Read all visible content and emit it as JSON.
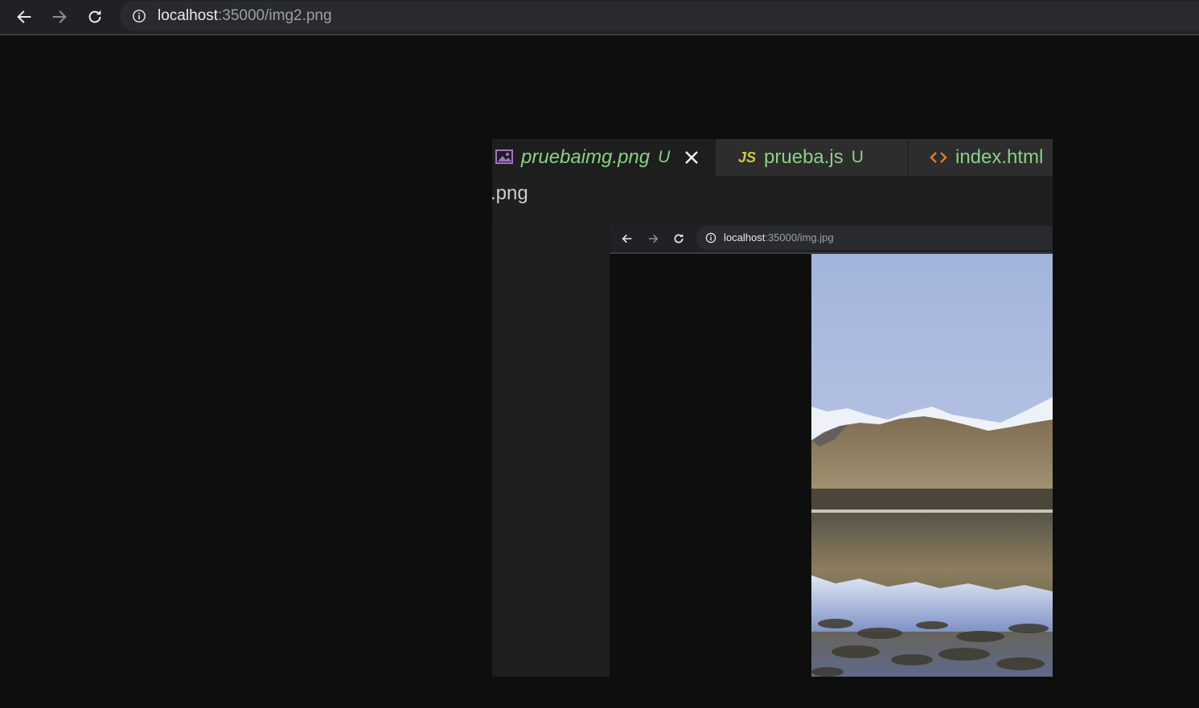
{
  "browser": {
    "url_host": "localhost",
    "url_path": ":35000/img2.png",
    "icons": {
      "back": "arrow-left-icon",
      "forward": "arrow-right-icon",
      "reload": "reload-icon",
      "info": "info-icon"
    }
  },
  "image_content": {
    "tabs": [
      {
        "label": "pruebaimg.png",
        "badge": "U",
        "icon": "image-file-icon",
        "active": true,
        "italic": true,
        "color": "#89d185",
        "icon_color": "#a074c4"
      },
      {
        "label": "prueba.js",
        "badge": "U",
        "icon": "js-file-icon",
        "icon_text": "JS",
        "active": false,
        "italic": false,
        "color": "#89d185",
        "icon_color": "#cbcb41"
      },
      {
        "label": "index.html",
        "badge": "",
        "icon": "html-file-icon",
        "active": false,
        "italic": false,
        "color": "#89d185",
        "icon_color": "#e37933"
      }
    ],
    "breadcrumb": ".png",
    "inner_browser": {
      "url_host": "localhost",
      "url_path": ":35000/img.jpg"
    },
    "photo": {
      "description_icon": "mountain-lake-photo",
      "colors": {
        "sky_top": "#a6b6dd",
        "sky_bottom": "#c3cfe6",
        "snow": "#eef1f7",
        "hill": "#8a7b5c",
        "water": "#6f6652",
        "reflection": "#b9c6e3"
      }
    }
  },
  "colors": {
    "page_bg": "#0e0e0e",
    "toolbar_bg": "#202124",
    "omnibox_bg": "#282a2d",
    "editor_bg": "#1f1f1f",
    "tab_text": "#89d185"
  }
}
